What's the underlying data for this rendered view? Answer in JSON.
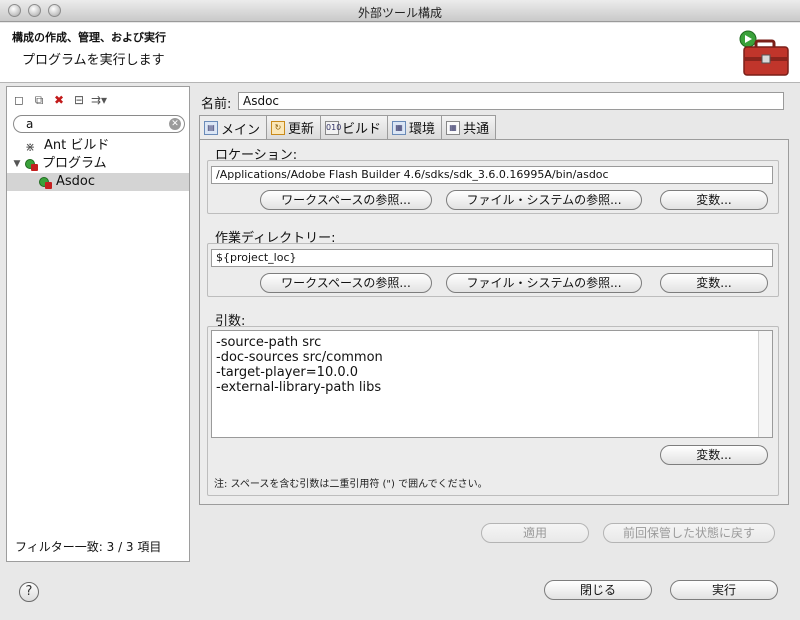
{
  "window": {
    "title": "外部ツール構成"
  },
  "banner": {
    "title": "構成の作成、管理、および実行",
    "subtitle": "プログラムを実行します",
    "icon": "toolbox-run-icon"
  },
  "left": {
    "toolbar_icons": [
      "new-config-icon",
      "duplicate-icon",
      "delete-icon",
      "collapse-all-icon",
      "filter-menu-icon"
    ],
    "filter": {
      "value": "a"
    },
    "tree": [
      {
        "label": "Ant ビルド",
        "level": 1,
        "expanded": false,
        "icon": "ant-icon"
      },
      {
        "label": "プログラム",
        "level": 0,
        "expanded": true,
        "icon": "program-icon"
      },
      {
        "label": "Asdoc",
        "level": 1,
        "selected": true,
        "icon": "program-config-icon"
      }
    ],
    "footer": "フィルター一致: 3 / 3 項目"
  },
  "form": {
    "name_label": "名前:",
    "name_value": "Asdoc",
    "tabs": [
      {
        "label": "メイン",
        "active": true,
        "icon": "main-tab-icon"
      },
      {
        "label": "更新",
        "icon": "refresh-tab-icon"
      },
      {
        "label": "ビルド",
        "icon": "build-tab-icon"
      },
      {
        "label": "環境",
        "icon": "environment-tab-icon"
      },
      {
        "label": "共通",
        "icon": "common-tab-icon"
      }
    ],
    "location": {
      "label": "ロケーション:",
      "value": "/Applications/Adobe Flash Builder 4.6/sdks/sdk_3.6.0.16995A/bin/asdoc",
      "buttons": [
        "ワークスペースの参照...",
        "ファイル・システムの参照...",
        "変数..."
      ]
    },
    "working_dir": {
      "label": "作業ディレクトリー:",
      "value": "${project_loc}",
      "buttons": [
        "ワークスペースの参照...",
        "ファイル・システムの参照...",
        "変数..."
      ]
    },
    "arguments": {
      "label": "引数:",
      "lines": [
        "-source-path src",
        "-doc-sources src/common",
        "-target-player=10.0.0",
        "-external-library-path libs"
      ],
      "variables_button": "変数...",
      "note": "注: スペースを含む引数は二重引用符 (\") で囲んでください。"
    },
    "apply_button": "適用",
    "revert_button": "前回保管した状態に戻す"
  },
  "footer": {
    "help_icon": "help-icon",
    "close_button": "閉じる",
    "run_button": "実行"
  },
  "colors": {
    "window_bg": "#e8e8e8",
    "selection": "#d4d4d4",
    "delete_red": "#c21a1a",
    "run_green": "#3aa13a",
    "toolbox_red": "#c0352b"
  }
}
